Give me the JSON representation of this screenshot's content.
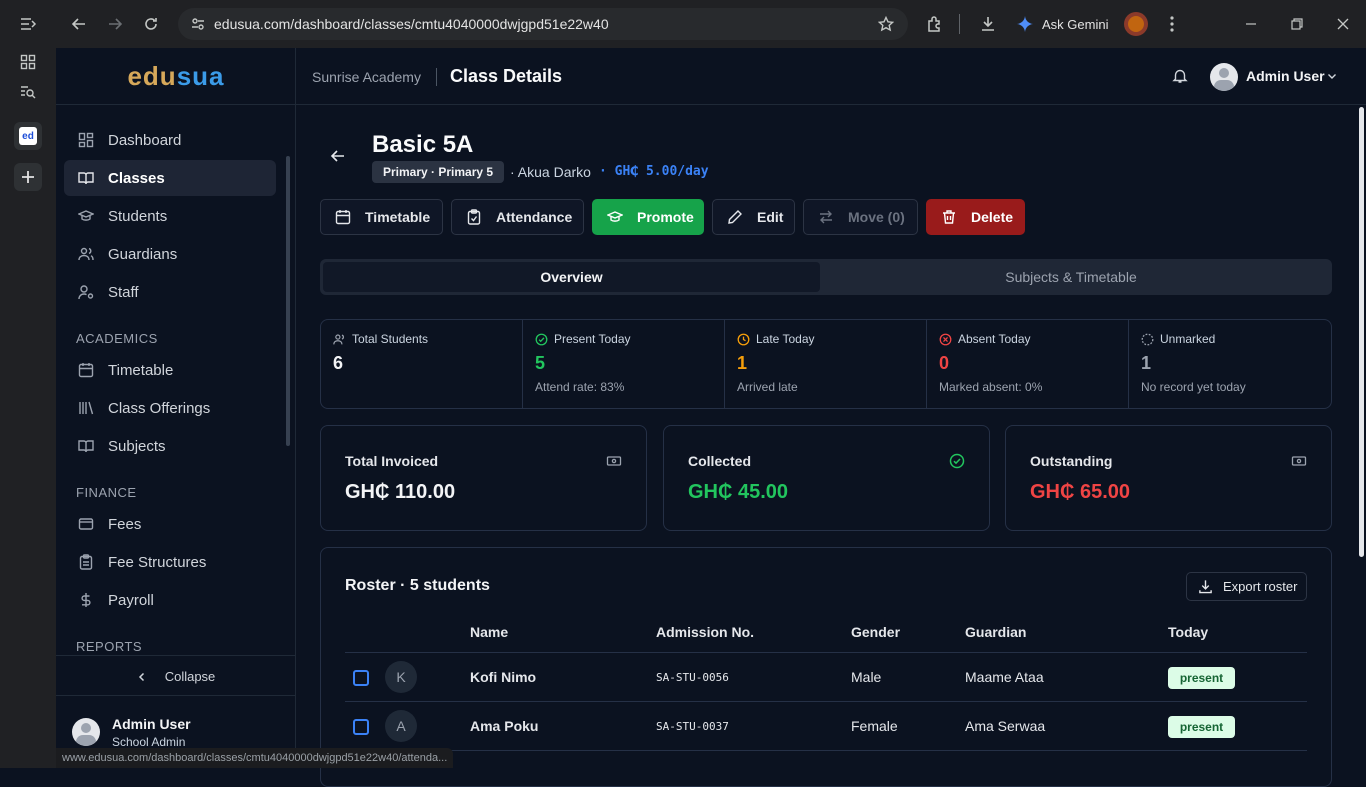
{
  "browser": {
    "url": "edusua.com/dashboard/classes/cmtu4040000dwjgpd51e22w40",
    "ask_gemini": "Ask Gemini",
    "status_url": "www.edusua.com/dashboard/classes/cmtu4040000dwjgpd51e22w40/attenda...",
    "side_favicon": "ed"
  },
  "brand": {
    "part1": "edu",
    "part2": "sua"
  },
  "header": {
    "school": "Sunrise Academy",
    "page_title": "Class Details",
    "user_name": "Admin User"
  },
  "sidebar": {
    "items": [
      {
        "label": "Dashboard",
        "icon": "grid-icon"
      },
      {
        "label": "Classes",
        "icon": "book-open-icon"
      },
      {
        "label": "Students",
        "icon": "graduation-cap-icon"
      },
      {
        "label": "Guardians",
        "icon": "users-icon"
      },
      {
        "label": "Staff",
        "icon": "user-cog-icon"
      }
    ],
    "academics_title": "ACADEMICS",
    "academics": [
      {
        "label": "Timetable",
        "icon": "calendar-icon"
      },
      {
        "label": "Class Offerings",
        "icon": "library-icon"
      },
      {
        "label": "Subjects",
        "icon": "book-open-icon"
      }
    ],
    "finance_title": "FINANCE",
    "finance": [
      {
        "label": "Fees",
        "icon": "wallet-icon"
      },
      {
        "label": "Fee Structures",
        "icon": "clipboard-icon"
      },
      {
        "label": "Payroll",
        "icon": "dollar-icon"
      }
    ],
    "reports_title": "REPORTS",
    "collapse_label": "Collapse",
    "user": {
      "name": "Admin User",
      "role": "School Admin"
    }
  },
  "class": {
    "name": "Basic 5A",
    "level_badge": "Primary · Primary 5",
    "teacher": "· Akua Darko",
    "fee_rate": "· GH₵ 5.00/day"
  },
  "actions": {
    "timetable": "Timetable",
    "attendance": "Attendance",
    "promote": "Promote",
    "edit": "Edit",
    "move": "Move (0)",
    "delete": "Delete"
  },
  "tabs": {
    "overview": "Overview",
    "subjects": "Subjects & Timetable"
  },
  "stats": [
    {
      "label": "Total Students",
      "value": "6",
      "sub": "",
      "color": "#f3f4f6"
    },
    {
      "label": "Present Today",
      "value": "5",
      "sub": "Attend rate: 83%",
      "color": "#22c55e"
    },
    {
      "label": "Late Today",
      "value": "1",
      "sub": "Arrived late",
      "color": "#f59e0b"
    },
    {
      "label": "Absent Today",
      "value": "0",
      "sub": "Marked absent: 0%",
      "color": "#ef4444"
    },
    {
      "label": "Unmarked",
      "value": "1",
      "sub": "No record yet today",
      "color": "#9ca3af"
    }
  ],
  "finance_cards": [
    {
      "title": "Total Invoiced",
      "value": "GH₵ 110.00",
      "color": "#f3f4f6"
    },
    {
      "title": "Collected",
      "value": "GH₵ 45.00",
      "color": "#22c55e"
    },
    {
      "title": "Outstanding",
      "value": "GH₵ 65.00",
      "color": "#ef4444"
    }
  ],
  "roster": {
    "title": "Roster · 5 students",
    "export_label": "Export roster",
    "columns": [
      "Name",
      "Admission No.",
      "Gender",
      "Guardian",
      "Today"
    ],
    "rows": [
      {
        "initial": "K",
        "name": "Kofi Nimo",
        "admission": "SA-STU-0056",
        "gender": "Male",
        "guardian": "Maame Ataa",
        "status": "present"
      },
      {
        "initial": "A",
        "name": "Ama Poku",
        "admission": "SA-STU-0037",
        "gender": "Female",
        "guardian": "Ama Serwaa",
        "status": "present"
      }
    ]
  }
}
